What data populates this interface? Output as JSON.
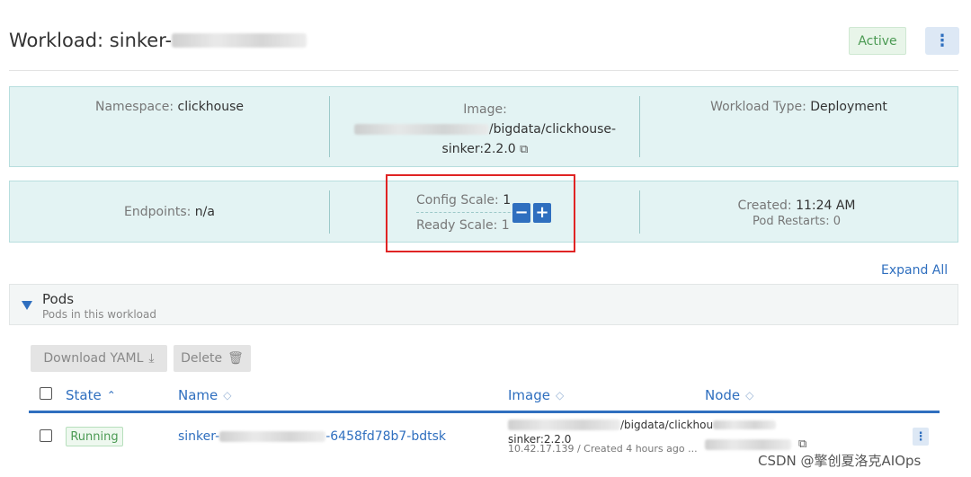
{
  "header": {
    "title_prefix": "Workload: sinker-",
    "status": "Active",
    "menu_icon": "kebab-vertical-icon"
  },
  "info_top": {
    "namespace_label": "Namespace:",
    "namespace_value": "clickhouse",
    "image_label": "Image:",
    "image_value_line1": "/bigdata/clickhouse-",
    "image_value_line2": "sinker:2.2.0",
    "workload_type_label": "Workload Type:",
    "workload_type_value": "Deployment"
  },
  "info_bottom": {
    "endpoints_label": "Endpoints:",
    "endpoints_value": "n/a",
    "config_scale_label": "Config Scale:",
    "config_scale_value": "1",
    "ready_scale_label": "Ready Scale:",
    "ready_scale_value": "1",
    "scale_down": "−",
    "scale_up": "+",
    "created_label": "Created:",
    "created_value": "11:24 AM",
    "restarts_label": "Pod Restarts:",
    "restarts_value": "0"
  },
  "expand_all": "Expand All",
  "pods": {
    "title": "Pods",
    "subtitle": "Pods in this workload",
    "download_yaml": "Download YAML",
    "delete": "Delete",
    "columns": {
      "state": "State",
      "name": "Name",
      "image": "Image",
      "node": "Node"
    },
    "rows": [
      {
        "state": "Running",
        "name_prefix": "sinker-",
        "name_suffix": "-6458fd78b7-bdtsk",
        "image_line1": "/bigdata/clickhou",
        "image_line2": "sinker:2.2.0",
        "image_sub": "10.42.17.139 / Created 4 hours ago ..."
      }
    ]
  },
  "watermark": "CSDN @擎创夏洛克AIOps",
  "colors": {
    "accent": "#2f6fbf",
    "info_bg": "#e3f3f3",
    "success": "#4b9a53",
    "highlight": "#e02424"
  }
}
